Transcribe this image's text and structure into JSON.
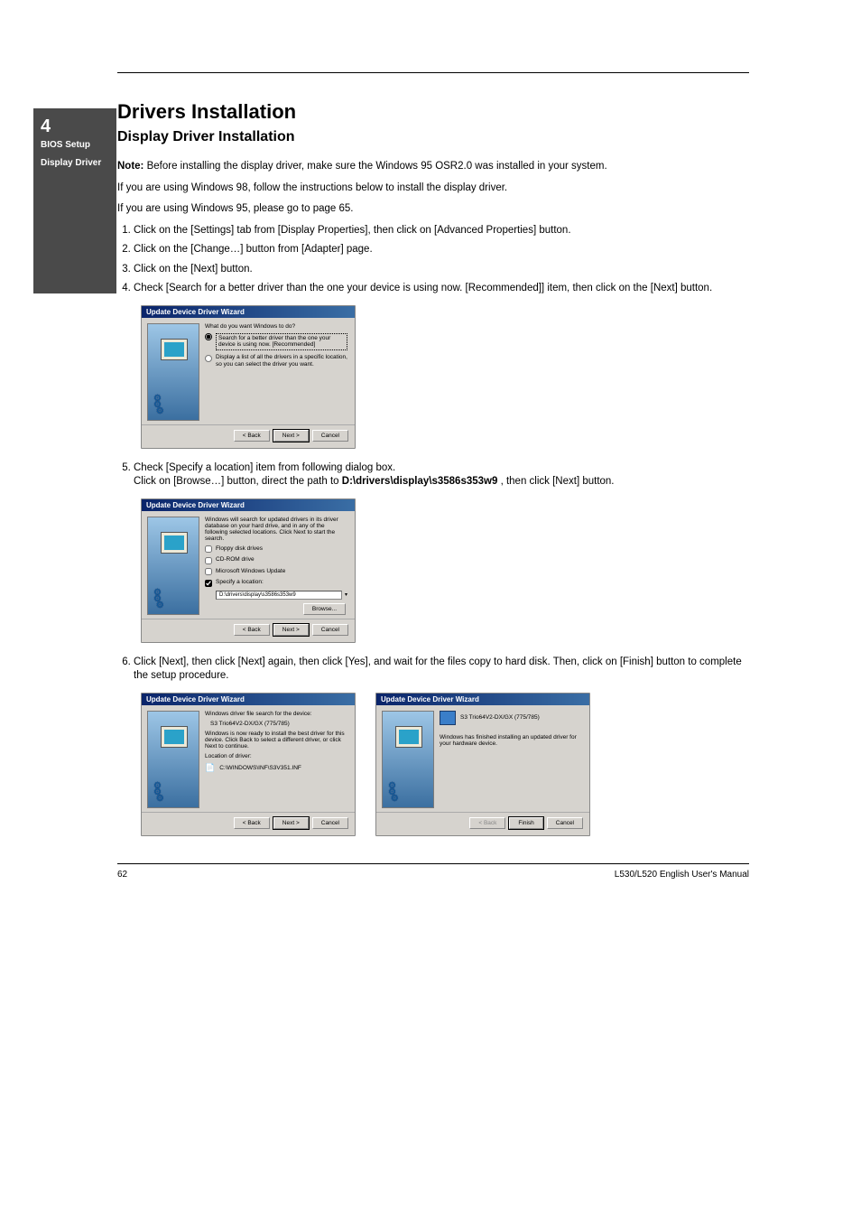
{
  "sideTab": {
    "chapter_num": "4",
    "chapter_word": "BIOS Setup",
    "sub": "Display Driver"
  },
  "header": {
    "title": "Drivers Installation",
    "subtitle": "Display Driver Installation"
  },
  "intro": {
    "note_label": "Note:",
    "note_body": "Before installing the display driver, make sure the Windows 95 OSR2.0 was installed in your system.",
    "p1": "If you are using Windows 98, follow the instructions below to install the display driver.",
    "p2": "If you are using Windows 95, please go to page 65."
  },
  "steps": {
    "s1": "Click on the [Settings] tab from [Display Properties], then click on [Advanced Properties] button.",
    "s2": "Click on the [Change…] button from [Adapter] page.",
    "s3": "Click on the [Next] button.",
    "s4": "Check [Search for a better driver than the one your device is using now. [Recommended]] item, then click on the [Next] button.",
    "s5a": "Check [Specify a location] item from following dialog box.",
    "s5b_prefix": "Click on [Browse…] button, direct the path to ",
    "s5b_path": "D:\\drivers\\display\\s3586s353w9",
    "s5b_suffix": ", then click [Next] button.",
    "s6": "Click [Next], then click [Next] again, then click [Yes], and wait for the files copy to hard disk. Then, click on [Finish] button to complete the setup procedure."
  },
  "wizard_common": {
    "title": "Update Device Driver Wizard",
    "back": "< Back",
    "next": "Next >",
    "cancel": "Cancel",
    "finish": "Finish"
  },
  "wizard1": {
    "q": "What do you want Windows to do?",
    "opt1": "Search for a better driver than the one your device is using now. [Recommended]",
    "opt2": "Display a list of all the drivers in a specific location, so you can select the driver you want."
  },
  "wizard2": {
    "intro": "Windows will search for updated drivers in its driver database on your hard drive, and in any of the following selected locations. Click Next to start the search.",
    "c1": "Floppy disk drives",
    "c2": "CD-ROM drive",
    "c3": "Microsoft Windows Update",
    "c4": "Specify a location:",
    "path": "D:\\drivers\\display\\s3586s353w9",
    "browse": "Browse..."
  },
  "wizard3": {
    "l1": "Windows driver file search for the device:",
    "device": "S3 Trio64V2-DX/GX (775/785)",
    "l2": "Windows is now ready to install the best driver for this device. Click Back to select a different driver, or click Next to continue.",
    "l3": "Location of driver:",
    "loc": "C:\\WINDOWS\\INF\\S3V351.INF"
  },
  "wizard4": {
    "device": "S3 Trio64V2-DX/GX (775/785)",
    "msg": "Windows has finished installing an updated driver for your hardware device."
  },
  "footer": {
    "page": "62",
    "doc": "L530/L520 English User's Manual"
  }
}
